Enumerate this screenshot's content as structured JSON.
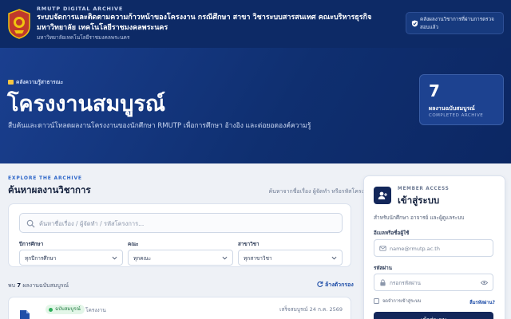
{
  "header": {
    "brand_small": "RMUTP DIGITAL ARCHIVE",
    "brand_title": "ระบบจัดการและติดตามความก้าวหน้าของโครงงาน กรณีศึกษา สาขา วิชาระบบสารสนเทศ คณะบริหารธุรกิจ มหาวิทยาลัย เทคโนโลยีราชมงคลพระนคร",
    "brand_sub": "มหาวิทยาลัยเทคโนโลยีราชมงคลพระนคร",
    "login_chip": "คลังผลงานวิชาการที่ผ่านการตรวจสอบแล้ว"
  },
  "hero": {
    "kicker": "คลังความรู้สาธารณะ",
    "title": "โครงงานสมบูรณ์",
    "description": "สืบค้นและดาวน์โหลดผลงานโครงงานของนักศึกษา RMUTP เพื่อการศึกษา อ้างอิง และต่อยอดองค์ความรู้",
    "stat": {
      "value": "7",
      "label": "ผลงานฉบับสมบูรณ์",
      "sub": "COMPLETED ARCHIVE"
    }
  },
  "explore": {
    "kicker": "EXPLORE THE ARCHIVE",
    "title": "ค้นหาผลงานวิชาการ",
    "hint": "ค้นหาจากชื่อเรื่อง ผู้จัดทำ หรือรหัสโครงการ"
  },
  "search": {
    "placeholder": "ค้นหาชื่อเรื่อง / ผู้จัดทำ / รหัสโครงการ..."
  },
  "filters": [
    {
      "label": "ปีการศึกษา",
      "value": "ทุกปีการศึกษา"
    },
    {
      "label": "คณะ",
      "value": "ทุกคณะ"
    },
    {
      "label": "สาขาวิชา",
      "value": "ทุกสาขาวิชา"
    }
  ],
  "results": {
    "prefix": "พบ",
    "count": "7",
    "suffix": "ผลงานฉบับสมบูรณ์",
    "reset": "ล้างตัวกรอง"
  },
  "item": {
    "badge": "ฉบับสมบูรณ์",
    "type": "โครงงาน",
    "date": "เสร็จสมบูรณ์ 24 ก.ค. 2569"
  },
  "login": {
    "kicker": "MEMBER ACCESS",
    "title": "เข้าสู่ระบบ",
    "description": "สำหรับนักศึกษา อาจารย์ และผู้ดูแลระบบ",
    "user_label": "อีเมลหรือชื่อผู้ใช้",
    "user_placeholder": "name@rmutp.ac.th",
    "pass_label": "รหัสผ่าน",
    "pass_placeholder": "กรอกรหัสผ่าน",
    "remember": "จดจำการเข้าสู่ระบบ",
    "forgot": "ลืมรหัสผ่าน?",
    "submit": "เข้าสู่ระบบ"
  },
  "colors": {
    "header_bg": "#0d2a66",
    "accent": "#1f4ea8",
    "dark_button": "#13275a",
    "badge_green": "#2fae5b"
  }
}
